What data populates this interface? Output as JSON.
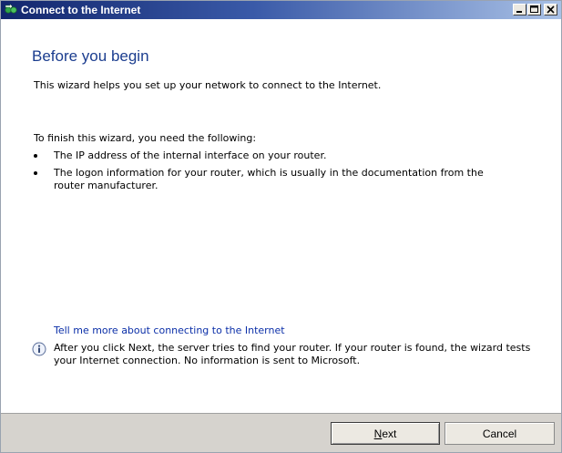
{
  "window": {
    "title": "Connect to the Internet",
    "icon": "network-connect-icon",
    "controls": [
      "minimize-icon",
      "maximize-icon",
      "close-icon"
    ]
  },
  "page": {
    "heading": "Before you begin",
    "intro": "This wizard helps you set up your network to connect to the Internet.",
    "requirements_title": "To finish this wizard, you need the following:",
    "requirements": [
      "The IP address of the internal interface on your router.",
      "The logon information for your router, which is usually in the documentation from the router manufacturer."
    ],
    "help_link": "Tell me more about connecting to the Internet",
    "info_text": "After you click Next, the server tries to find your router. If your router is found, the wizard tests your Internet connection.  No information is sent to Microsoft."
  },
  "footer": {
    "next_mnemonic": "N",
    "next_rest": "ext",
    "cancel_label": "Cancel"
  }
}
